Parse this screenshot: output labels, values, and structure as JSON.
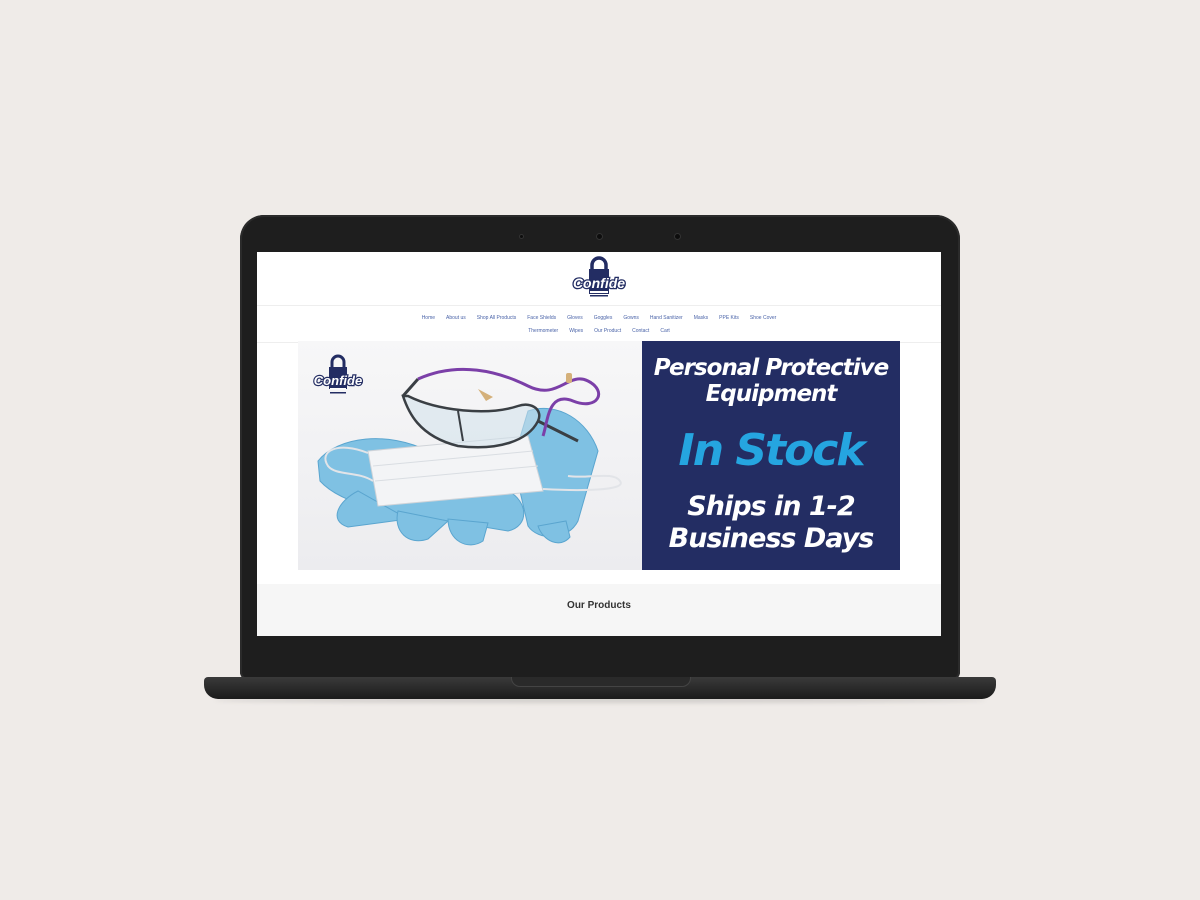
{
  "site": {
    "brand": "Confide",
    "nav_row1": [
      "Home",
      "About us",
      "Shop All Products",
      "Face Shields",
      "Gloves",
      "Goggles",
      "Gowns",
      "Hand Sanitizer",
      "Masks",
      "PPE Kits",
      "Shoe Cover"
    ],
    "nav_row2": [
      "Thermometer",
      "Wipes",
      "Our Product",
      "Contact",
      "Cart"
    ]
  },
  "hero": {
    "photo_brand": "Confide",
    "headline_1": "Personal Protective Equipment",
    "headline_2": "In Stock",
    "headline_3": "Ships in 1-2 Business Days"
  },
  "products": {
    "title": "Our Products"
  },
  "colors": {
    "accent": "#232d63",
    "highlight": "#25a5e0",
    "link": "#4a63a8"
  }
}
